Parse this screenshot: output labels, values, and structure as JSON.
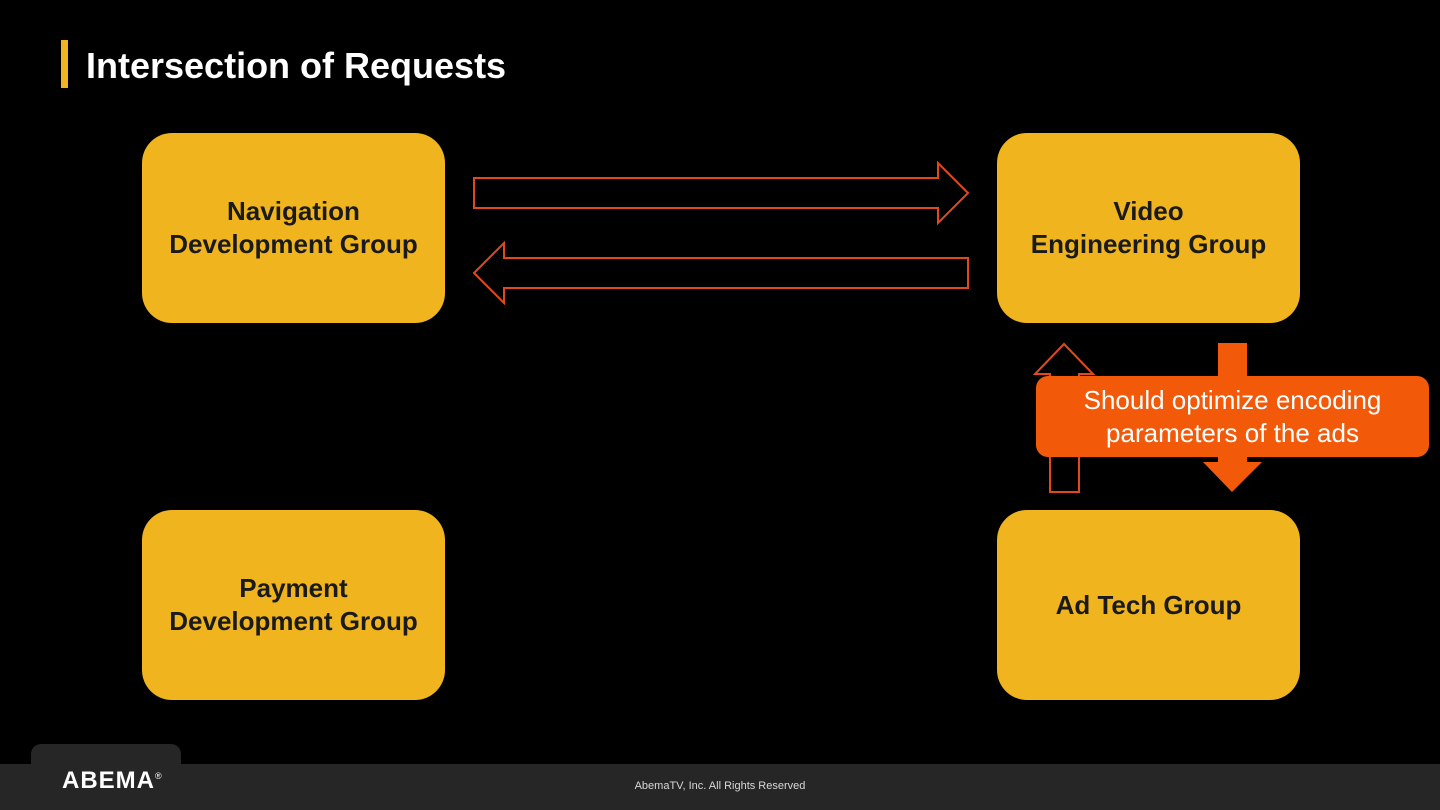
{
  "title": "Intersection of Requests",
  "groups": {
    "navigation": "Navigation\nDevelopment Group",
    "video": "Video\nEngineering Group",
    "payment": "Payment\nDevelopment Group",
    "adtech": "Ad Tech Group"
  },
  "callout": "Should optimize encoding\nparameters of the ads",
  "footer": {
    "logo": "ABEMA",
    "logo_mark": "®",
    "copyright": "AbemaTV, Inc. All Rights Reserved"
  },
  "colors": {
    "background": "#000000",
    "box": "#f0b41e",
    "accent": "#f25a0a",
    "arrow_outline": "#e04a1a",
    "footer": "#262626"
  }
}
